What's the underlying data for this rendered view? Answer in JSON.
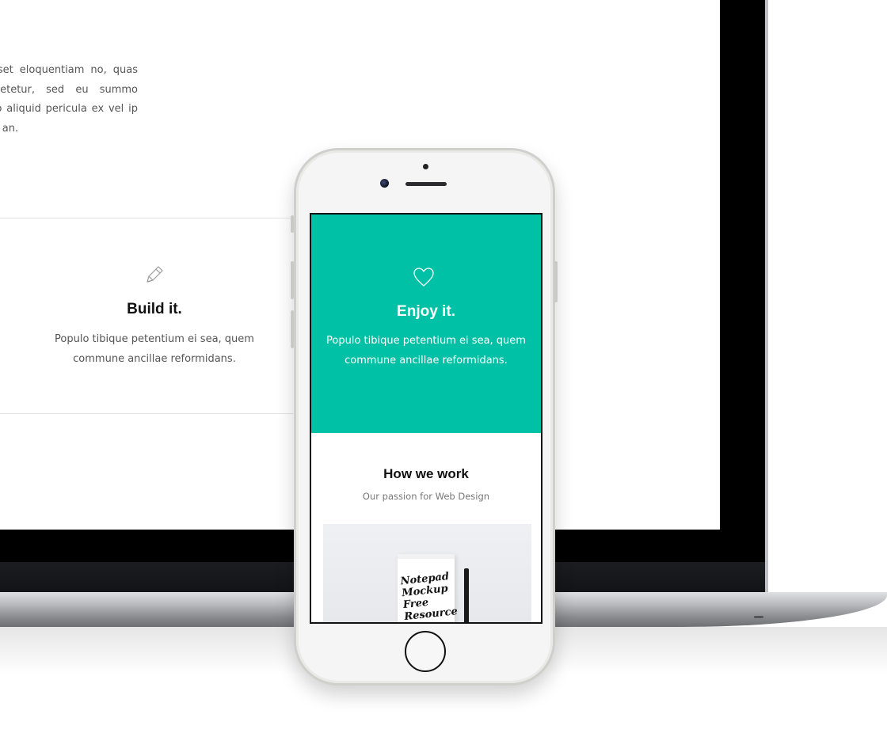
{
  "desktop": {
    "paragraph": "quisset eloquentiam no, quas consetetur, sed eu summo ubeo aliquid pericula ex vel ip mea an.",
    "feature": {
      "icon": "pencil-icon",
      "title": "Build it.",
      "text": "Populo tibique petentium ei sea, quem commune ancillae reformidans."
    }
  },
  "mobile": {
    "hero": {
      "icon": "heart-icon",
      "background": "#00c0a6",
      "title": "Enjoy it.",
      "text": "Populo tibique petentium ei sea, quem commune ancillae reformidans."
    },
    "section": {
      "title": "How we work",
      "subtitle": "Our passion for Web Design"
    },
    "image": {
      "notepad_text": "Notepad\nMockup\nFree\nResource"
    }
  }
}
